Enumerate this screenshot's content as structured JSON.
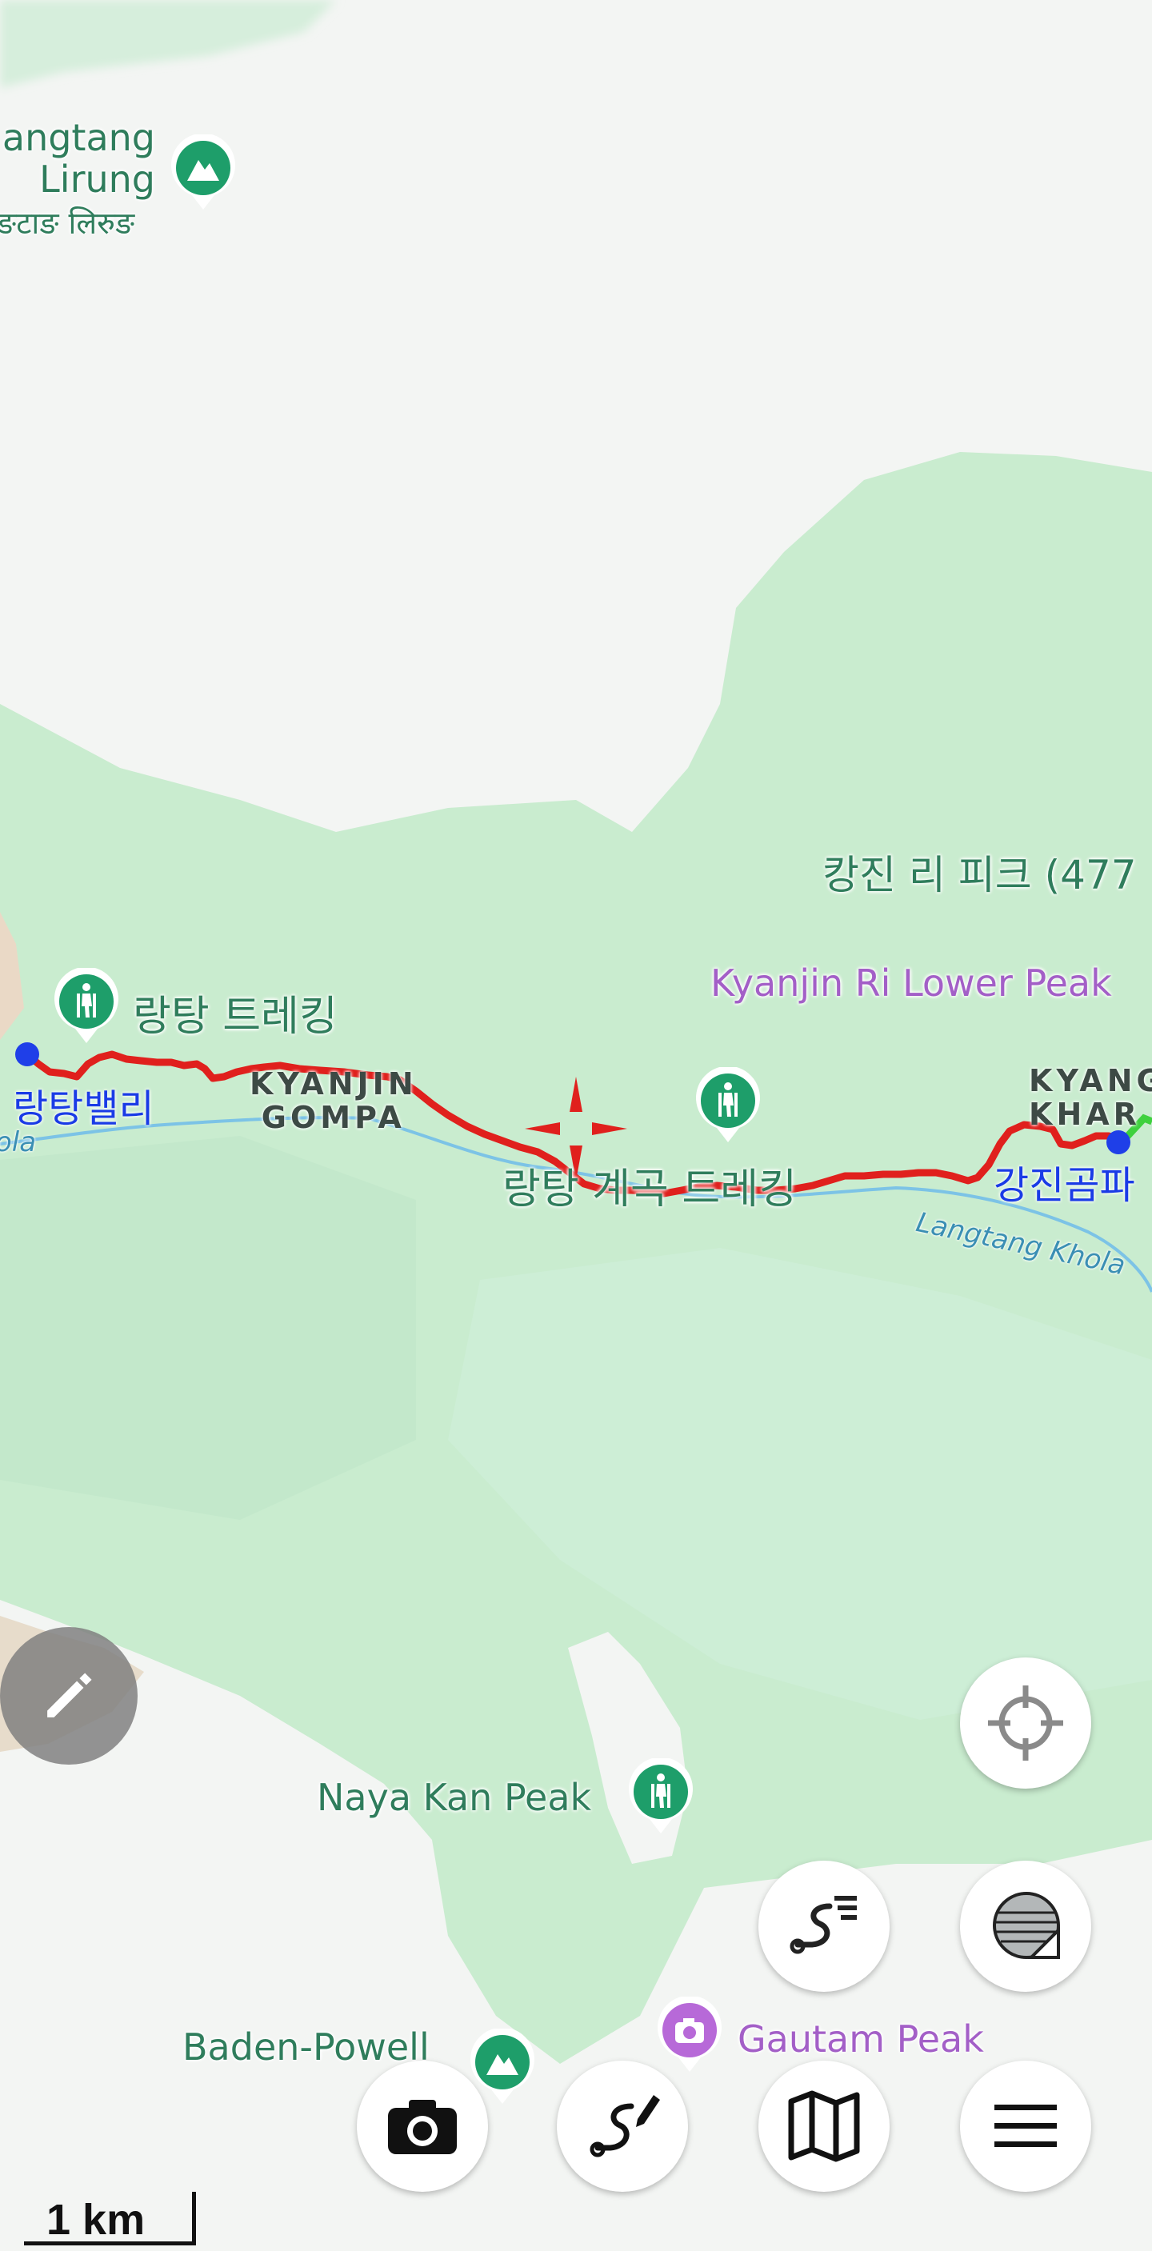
{
  "map": {
    "places": {
      "langtang_lirung": {
        "latin": "angtang\nLirung",
        "devanagari": "ङटाङ लिरुङ"
      },
      "kyanjin_ri_peak": "캉진 리 피크 (477",
      "kyanjin_ri_lower_peak": "Kyanjin Ri Lower Peak",
      "langtang_trekking": "랑탕 트레킹",
      "kyanjin_gompa": "KYANJIN\nGOMPA",
      "langtang_valley_trekking": "랑탕 계곡 트레킹",
      "kyangjin_kharka": "KYANG\nKHAR",
      "naya_kan_peak": "Naya Kan Peak",
      "baden_powell": "Baden-Powell",
      "gautam_peak": "Gautam Peak",
      "river_right": "Langtang Khola",
      "river_left": "ola"
    },
    "route": {
      "start_label": "랑탕밸리",
      "end_label": "강진곰파",
      "line_color": "#e0201d",
      "point_color": "#1f3fe8"
    },
    "scale_label": "1 km"
  },
  "controls": {
    "edit": "pencil-icon",
    "locate": "crosshair-icon",
    "track": "route-list-icon",
    "layers": "layers-icon",
    "camera": "camera-icon",
    "draw_route": "route-draw-icon",
    "map_type": "map-icon",
    "menu": "menu-icon"
  },
  "colors": {
    "forest": "#c9eccf",
    "snow": "#f3f5f3",
    "bare": "#ead9c6",
    "accent_green": "#1e9e6a"
  }
}
